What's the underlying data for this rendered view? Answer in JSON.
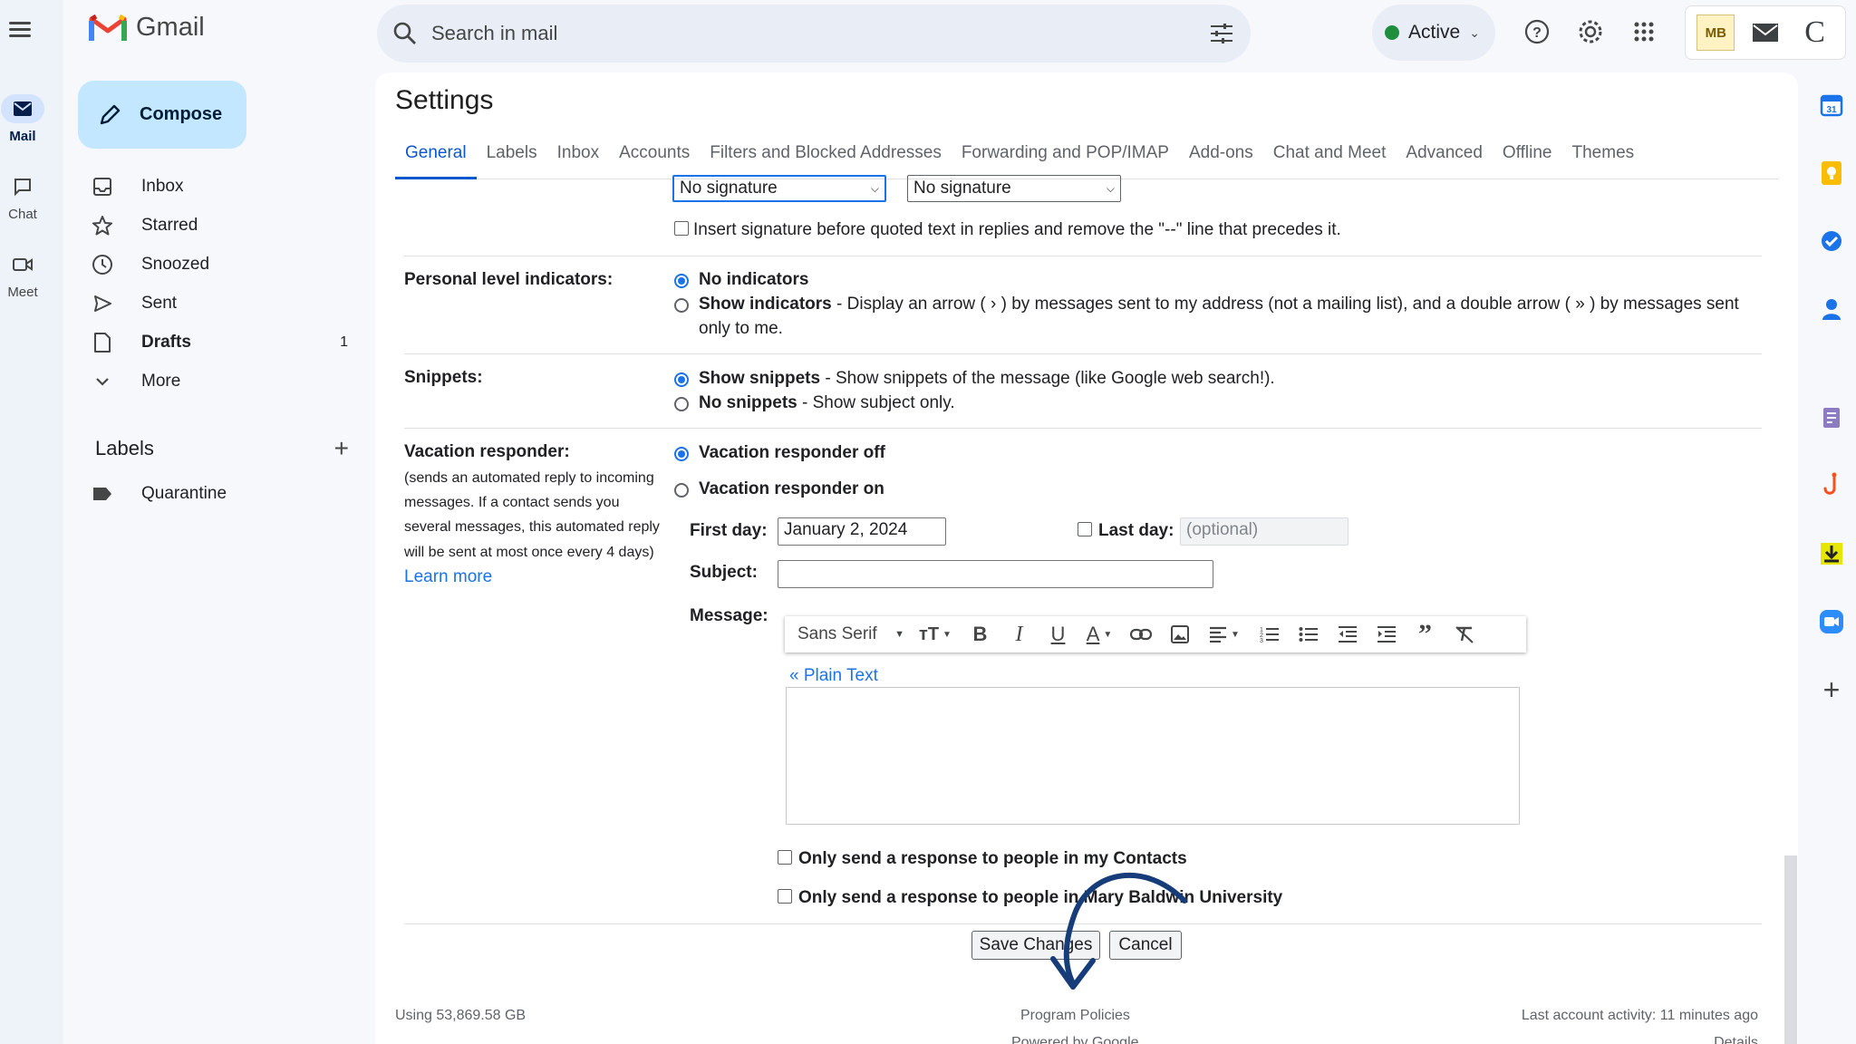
{
  "app": {
    "name": "Gmail"
  },
  "rail": {
    "items": [
      {
        "label": "Mail"
      },
      {
        "label": "Chat"
      },
      {
        "label": "Meet"
      }
    ]
  },
  "search": {
    "placeholder": "Search in mail"
  },
  "status": {
    "label": "Active",
    "color": "#1e8e3e"
  },
  "account_badges": [
    "MB",
    "mail",
    "C"
  ],
  "compose": {
    "label": "Compose"
  },
  "nav": {
    "items": [
      {
        "label": "Inbox",
        "icon": "inbox-icon"
      },
      {
        "label": "Starred",
        "icon": "star-icon"
      },
      {
        "label": "Snoozed",
        "icon": "clock-icon"
      },
      {
        "label": "Sent",
        "icon": "send-icon"
      },
      {
        "label": "Drafts",
        "icon": "draft-icon",
        "count": "1"
      },
      {
        "label": "More",
        "icon": "chevron-down-icon"
      }
    ]
  },
  "labels": {
    "heading": "Labels",
    "items": [
      {
        "label": "Quarantine"
      }
    ]
  },
  "settings": {
    "title": "Settings",
    "tabs": [
      "General",
      "Labels",
      "Inbox",
      "Accounts",
      "Filters and Blocked Addresses",
      "Forwarding and POP/IMAP",
      "Add-ons",
      "Chat and Meet",
      "Advanced",
      "Offline",
      "Themes"
    ],
    "active_tab": "General",
    "signature": {
      "select_new": "No signature",
      "select_reply": "No signature",
      "insert_before": "Insert signature before quoted text in replies and remove the \"--\" line that precedes it."
    },
    "personal_level": {
      "label": "Personal level indicators:",
      "opt1": "No indicators",
      "opt2_title": "Show indicators",
      "opt2_desc": " - Display an arrow ( › ) by messages sent to my address (not a mailing list), and a double arrow ( » ) by messages sent",
      "opt2_desc2": "only to me."
    },
    "snippets": {
      "label": "Snippets:",
      "opt1_title": "Show snippets",
      "opt1_desc": " - Show snippets of the message (like Google web search!).",
      "opt2_title": "No snippets",
      "opt2_desc": " - Show subject only."
    },
    "vacation": {
      "label": "Vacation responder:",
      "desc1": "(sends an automated reply to incoming",
      "desc2": "messages. If a contact sends you",
      "desc3": "several messages, this automated reply",
      "desc4": "will be sent at most once every 4 days)",
      "learn_more": "Learn more",
      "off": "Vacation responder off",
      "on": "Vacation responder on",
      "first_day_label": "First day:",
      "first_day_value": "January 2, 2024",
      "last_day_label": "Last day:",
      "last_day_placeholder": "(optional)",
      "subject_label": "Subject:",
      "message_label": "Message:",
      "font": "Sans Serif",
      "plain_text": "« Plain Text",
      "contacts_only": "Only send a response to people in my Contacts",
      "org_only": "Only send a response to people in Mary Baldwin University"
    },
    "save_label": "Save Changes",
    "cancel_label": "Cancel"
  },
  "footer": {
    "storage": "Using 53,869.58 GB",
    "policies": "Program Policies",
    "powered": "Powered by Google",
    "activity": "Last account activity: 11 minutes ago",
    "details": "Details"
  }
}
